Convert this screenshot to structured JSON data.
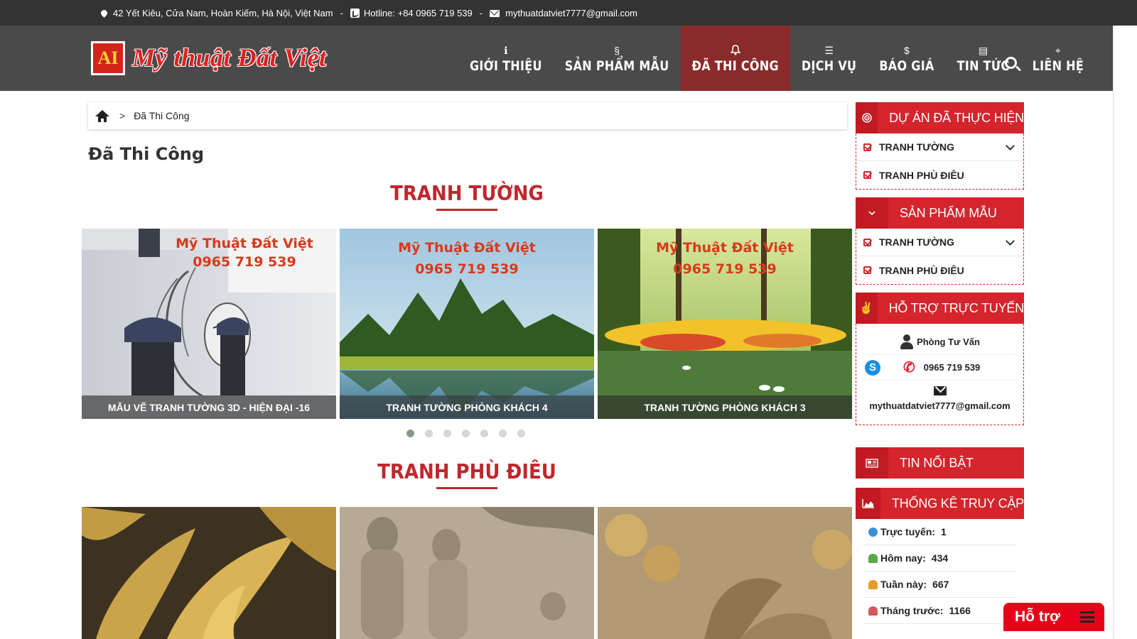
{
  "topbar": {
    "address": "42 Yết Kiêu, Cửa Nam, Hoàn Kiếm, Hà Nội, Việt Nam",
    "separator": "-",
    "hotline_label": "Hotline:",
    "hotline": "+84 0965 719 539",
    "email": "mythuatdatviet7777@gmail.com"
  },
  "logo": {
    "mark": "AI",
    "text": "Mỹ thuật Đất Việt"
  },
  "nav": {
    "items": [
      {
        "label": "GIỚI THIỆU",
        "icon": "info-icon",
        "glyph": "ℹ"
      },
      {
        "label": "SẢN PHẨM MẪU",
        "icon": "spiral-icon",
        "glyph": "§"
      },
      {
        "label": "ĐÃ THI CÔNG",
        "icon": "bell-icon",
        "glyph": "🔔"
      },
      {
        "label": "DỊCH VỤ",
        "icon": "server-icon",
        "glyph": "☰"
      },
      {
        "label": "BÁO GIÁ",
        "icon": "dollar-icon",
        "glyph": "$"
      },
      {
        "label": "TIN TỨC",
        "icon": "newspaper-icon",
        "glyph": "▤"
      },
      {
        "label": "LIÊN HỆ",
        "icon": "map-marker-icon",
        "glyph": "⌖"
      }
    ],
    "active_index": 2
  },
  "breadcrumb": {
    "sep": ">",
    "current": "Đã Thi Công"
  },
  "page_title": "Đã Thi Công",
  "sections": {
    "murals": {
      "title": "TRANH TƯỜNG",
      "cards": [
        {
          "caption": "MẪU VẼ TRANH TƯỜNG 3D - HIỆN ĐẠI -16"
        },
        {
          "caption": "TRANH TƯỜNG PHÒNG KHÁCH 4"
        },
        {
          "caption": "TRANH TƯỜNG PHÒNG KHÁCH 3"
        }
      ],
      "watermark_name": "Mỹ Thuật Đất Việt",
      "watermark_phone": "0965 719 539",
      "dots": 7,
      "active_dot": 0
    },
    "reliefs": {
      "title": "TRANH PHÙ ĐIÊU"
    }
  },
  "sidebar": {
    "projects": {
      "title": "DỰ ÁN ĐÃ THỰC HIỆN",
      "items": [
        "TRANH TƯỜNG",
        "TRANH PHÙ ĐIÊU"
      ]
    },
    "samples": {
      "title": "SẢN PHẨM MẪU",
      "items": [
        "TRANH TƯỜNG",
        "TRANH PHÙ ĐIÊU"
      ]
    },
    "support": {
      "title": "HỖ TRỢ TRỰC TUYẾN",
      "dept": "Phòng Tư Vấn",
      "phone": "0965 719 539",
      "email": "mythuatdatviet7777@gmail.com"
    },
    "news": {
      "title": "TIN NỔI BẬT"
    },
    "stats": {
      "title": "THỐNG KÊ TRUY CẬP",
      "rows": [
        {
          "label": "Trực tuyến:",
          "value": "1",
          "color": "#3d8fd6"
        },
        {
          "label": "Hôm nay:",
          "value": "434",
          "color": "#5aa84a"
        },
        {
          "label": "Tuần này:",
          "value": "667",
          "color": "#e89a2a"
        },
        {
          "label": "Tháng trước:",
          "value": "1166",
          "color": "#d65a5a"
        }
      ]
    }
  },
  "support_widget": {
    "label": "Hỗ trợ"
  },
  "colors": {
    "accent": "#d4242c",
    "header_bg": "#4a4a4a",
    "topbar_bg": "#333333"
  }
}
